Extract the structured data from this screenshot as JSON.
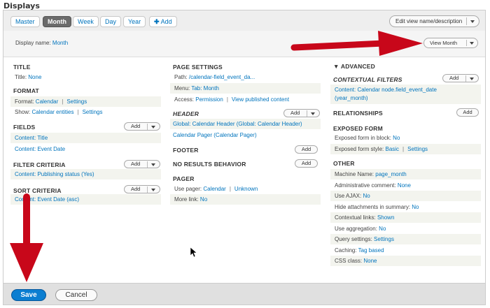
{
  "heading": "Displays",
  "tabs": [
    "Master",
    "Month",
    "Week",
    "Day",
    "Year"
  ],
  "add_tab": "Add",
  "edit_view_btn": "Edit view name/description",
  "display_name": {
    "label": "Display name:",
    "value": "Month"
  },
  "view_month_btn": "View Month",
  "col1": {
    "title": {
      "heading": "TITLE",
      "label": "Title:",
      "value": "None"
    },
    "format": {
      "heading": "FORMAT",
      "format_label": "Format:",
      "format_value": "Calendar",
      "format_settings": "Settings",
      "show_label": "Show:",
      "show_value": "Calendar entities",
      "show_settings": "Settings"
    },
    "fields": {
      "heading": "FIELDS",
      "add": "Add",
      "items": [
        "Content: Title",
        "Content: Event Date"
      ]
    },
    "filter": {
      "heading": "FILTER CRITERIA",
      "add": "Add",
      "items": [
        "Content: Publishing status (Yes)"
      ]
    },
    "sort": {
      "heading": "SORT CRITERIA",
      "add": "Add",
      "items": [
        "Content: Event Date (asc)"
      ]
    }
  },
  "col2": {
    "page_settings": {
      "heading": "PAGE SETTINGS",
      "path_label": "Path:",
      "path_value": "/calendar-field_event_da...",
      "menu_label": "Menu:",
      "menu_value": "Tab: Month",
      "access_label": "Access:",
      "access_value": "Permission",
      "access_link": "View published content"
    },
    "header": {
      "heading": "HEADER",
      "add": "Add",
      "items": [
        "Global: Calendar Header (Global: Calendar Header)",
        "Calendar Pager (Calendar Pager)"
      ]
    },
    "footer": {
      "heading": "FOOTER",
      "add": "Add"
    },
    "no_results": {
      "heading": "NO RESULTS BEHAVIOR",
      "add": "Add"
    },
    "pager": {
      "heading": "PAGER",
      "use_label": "Use pager:",
      "use_value": "Calendar",
      "use_value2": "Unknown",
      "more_label": "More link:",
      "more_value": "No"
    }
  },
  "col3": {
    "advanced": "▼ ADVANCED",
    "contextual": {
      "heading": "CONTEXTUAL FILTERS",
      "add": "Add",
      "item_line1": "Content: Calendar node.field_event_date",
      "item_line2": "(year_month)"
    },
    "relationships": {
      "heading": "RELATIONSHIPS",
      "add": "Add"
    },
    "exposed": {
      "heading": "EXPOSED FORM",
      "block_label": "Exposed form in block:",
      "block_value": "No",
      "style_label": "Exposed form style:",
      "style_value": "Basic",
      "style_settings": "Settings"
    },
    "other": {
      "heading": "OTHER",
      "machine_label": "Machine Name:",
      "machine_value": "page_month",
      "admin_label": "Administrative comment:",
      "admin_value": "None",
      "ajax_label": "Use AJAX:",
      "ajax_value": "No",
      "hide_label": "Hide attachments in summary:",
      "hide_value": "No",
      "ctx_label": "Contextual links:",
      "ctx_value": "Shown",
      "agg_label": "Use aggregation:",
      "agg_value": "No",
      "query_label": "Query settings:",
      "query_value": "Settings",
      "cache_label": "Caching:",
      "cache_value": "Tag based",
      "css_label": "CSS class:",
      "css_value": "None"
    }
  },
  "footer": {
    "save": "Save",
    "cancel": "Cancel"
  },
  "colors": {
    "link": "#0074bd",
    "save_bg": "#0b7ed1",
    "arrow": "#c8071a"
  }
}
